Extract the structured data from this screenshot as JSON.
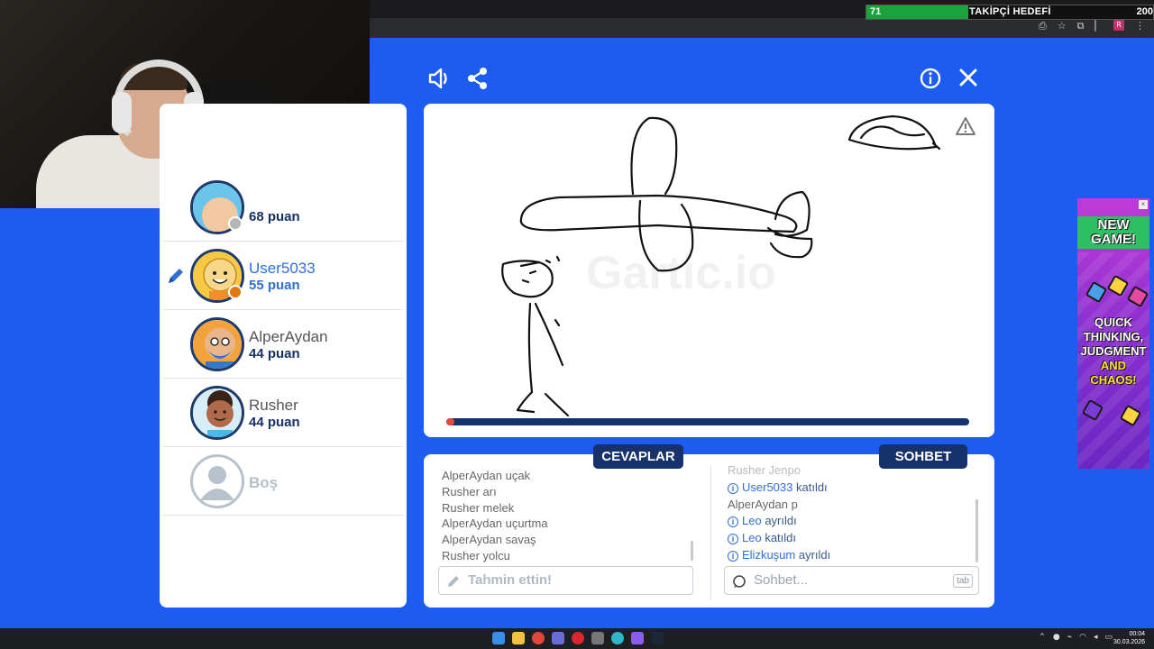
{
  "overlay": {
    "goal_current": "71",
    "goal_label": "TAKİPÇİ HEDEFİ",
    "goal_target": "200",
    "goal_progress_fraction": 0.355
  },
  "browser": {
    "window_controls": [
      "–",
      "▫",
      "✕"
    ],
    "toolbar_icons": [
      "install-icon",
      "star-icon",
      "extensions-icon",
      "profile-icon",
      "menu-icon"
    ],
    "ext_badge": "R"
  },
  "game": {
    "toolbar": {
      "sound_icon": "speaker-icon",
      "share_icon": "share-icon",
      "info_icon": "info-icon",
      "close_icon": "close-icon"
    },
    "players": [
      {
        "name": "",
        "score": "68 puan",
        "status_color": "#b5b5b5",
        "active": false,
        "avatar_bg": "#6bc5ea"
      },
      {
        "name": "User5033",
        "score": "55 puan",
        "status_color": "#e07810",
        "active": true,
        "avatar_bg": "#f6c945"
      },
      {
        "name": "AlperAydan",
        "score": "44 puan",
        "status_color": "",
        "active": false,
        "avatar_bg": "#f3a33b"
      },
      {
        "name": "Rusher",
        "score": "44 puan",
        "status_color": "",
        "active": false,
        "avatar_bg": "#8e5a3a"
      },
      {
        "name": "Boş",
        "score": "",
        "status_color": "",
        "active": false,
        "avatar_bg": "#e6eaee"
      }
    ],
    "canvas": {
      "watermark": "Gartic.io",
      "timer_fraction": 0.015,
      "warning_icon": "warning-icon"
    },
    "tabs": {
      "answers": "CEVAPLAR",
      "chat": "SOHBET"
    },
    "answers": [
      {
        "user": "AlperAydan",
        "text": "uçak"
      },
      {
        "user": "Rusher",
        "text": "arı"
      },
      {
        "user": "Rusher",
        "text": "melek"
      },
      {
        "user": "AlperAydan",
        "text": "uçurtma"
      },
      {
        "user": "AlperAydan",
        "text": "savaş"
      },
      {
        "user": "Rusher",
        "text": "yolcu"
      }
    ],
    "chat": [
      {
        "type": "user",
        "user": "Rusher",
        "text": "Jenpo"
      },
      {
        "type": "sys",
        "user": "User5033",
        "text": "katıldı"
      },
      {
        "type": "user",
        "user": "AlperAydan",
        "text": "p"
      },
      {
        "type": "sys",
        "user": "Leo",
        "text": "ayrıldı"
      },
      {
        "type": "sys",
        "user": "Leo",
        "text": "katıldı"
      },
      {
        "type": "sys",
        "user": "Elizkuşum",
        "text": "ayrıldı"
      }
    ],
    "guess_placeholder": "Tahmin ettin!",
    "chat_placeholder": "Sohbet...",
    "tab_key": "tab"
  },
  "ad": {
    "title": "NEW GAME!",
    "line1": "QUICK",
    "line2": "THINKING,",
    "line3": "JUDGMENT",
    "line4": "AND",
    "line5": "CHAOS!"
  },
  "taskbar": {
    "time": "00:04",
    "date": "30.03.2026",
    "tray_icons": [
      "chevron-up-icon",
      "mic-icon",
      "usb-icon",
      "wifi-icon",
      "volume-icon",
      "battery-icon"
    ]
  }
}
